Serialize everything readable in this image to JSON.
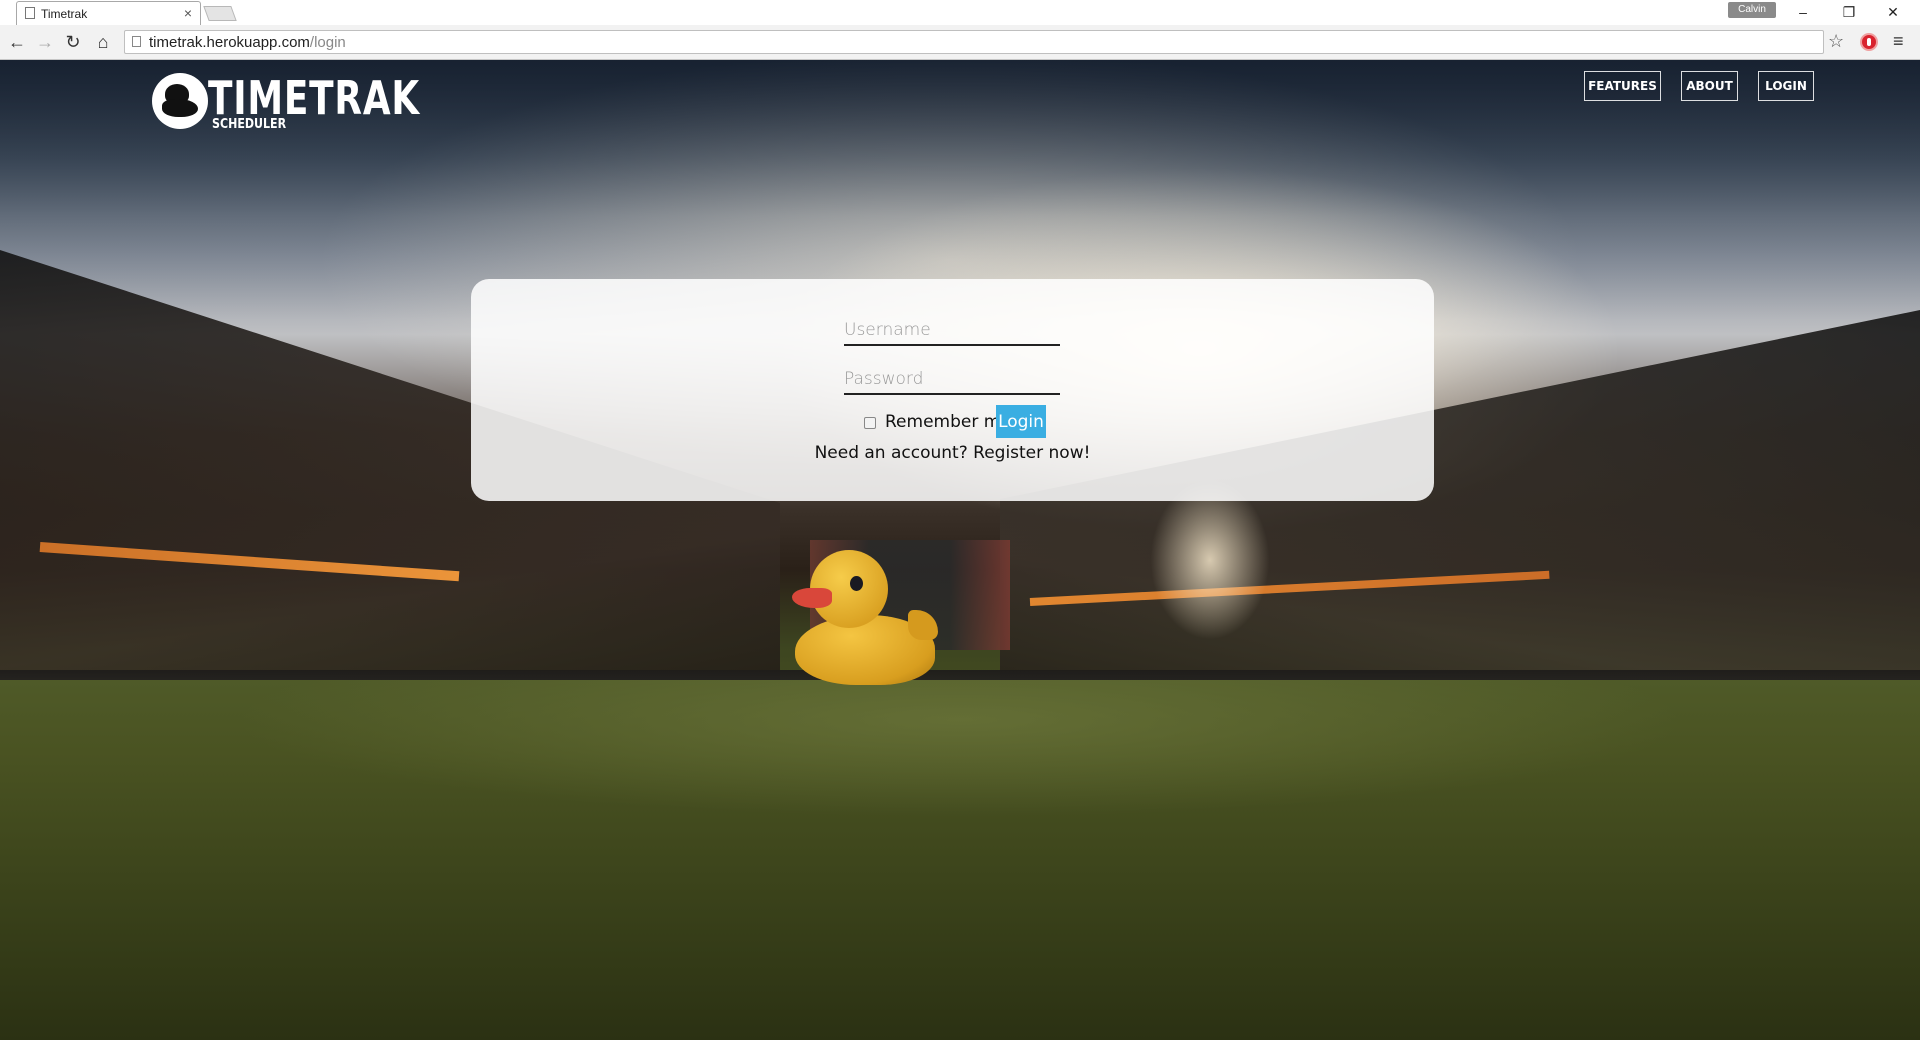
{
  "browser": {
    "tab_title": "Timetrak",
    "tab_close": "×",
    "profile_name": "Calvin",
    "url_host": "timetrak.herokuapp.com",
    "url_path": "/login",
    "window_controls": {
      "minimize": "–",
      "restore": "❐",
      "close": "✕"
    },
    "nav_icons": {
      "back": "←",
      "forward": "→",
      "reload": "↻",
      "home": "⌂",
      "star": "☆",
      "menu": "≡"
    }
  },
  "header": {
    "logo_text": "TIMETRAK",
    "logo_subtext": "SCHEDULER",
    "nav": [
      {
        "label": "FEATURES"
      },
      {
        "label": "ABOUT"
      },
      {
        "label": "LOGIN"
      }
    ]
  },
  "login_form": {
    "username_placeholder": "Username",
    "password_placeholder": "Password",
    "remember_label": "Remember me",
    "submit_label": "Login",
    "register_text": "Need an account? Register now!"
  },
  "colors": {
    "login_button": "#3aaee2",
    "card_background": "rgba(255,255,255,0.86)"
  }
}
